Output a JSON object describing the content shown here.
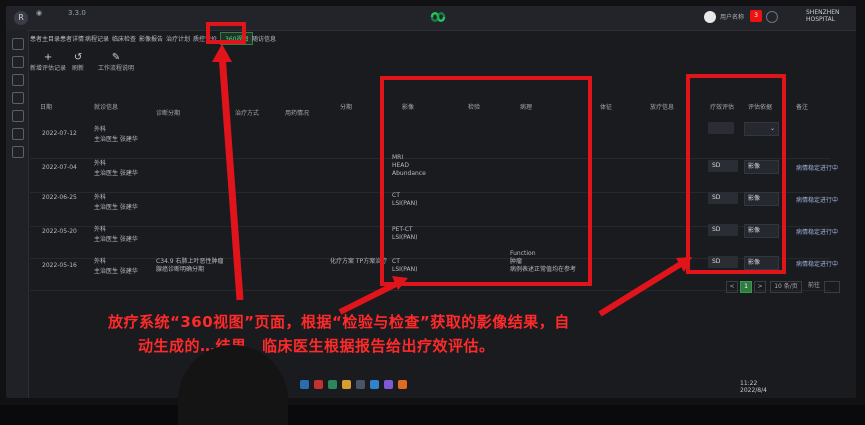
{
  "window": {
    "title_left_1": "R",
    "title_left_2": "3.3.0",
    "user_label": "用户名称",
    "notif_label": "3",
    "brand_text": "SHENZHEN HOSPITAL"
  },
  "menu": {
    "items": [
      "患者主目录",
      "患者详情",
      "病程记录",
      "临床检查",
      "影像报告",
      "治疗计划",
      "质控评价",
      "360视图",
      "随访信息"
    ],
    "active_index": 7
  },
  "toolbar": {
    "tools": [
      {
        "glyph": "+",
        "label": "新增评估记录"
      },
      {
        "glyph": "↺",
        "label": "刷新"
      },
      {
        "glyph": "✎",
        "label": "工作流程说明"
      }
    ]
  },
  "table": {
    "headers": [
      "日期",
      "就诊信息",
      "诊断分期",
      "治疗方式",
      "用药情况",
      "分期",
      "影像",
      "检验",
      "病理",
      "体征",
      "放疗信息",
      "疗效评估",
      "评估依据",
      "备注"
    ],
    "rows": [
      {
        "date": "2022-07-12",
        "visit": "外科",
        "sub": "主治医生 张建华",
        "imaging": "",
        "lab": "",
        "score": "",
        "select": "",
        "note": ""
      },
      {
        "date": "2022-07-04",
        "visit": "外科",
        "sub": "主治医生 张建华",
        "imaging": "MRI\nHEAD\nAbundance",
        "lab": "",
        "score": "SD",
        "select": "影像",
        "note": "病情稳定进行中"
      },
      {
        "date": "2022-06-25",
        "visit": "外科",
        "sub": "主治医生 张建华",
        "imaging": "CT\nLSI(PAN)",
        "lab": "",
        "score": "SD",
        "select": "影像",
        "note": "病情稳定进行中"
      },
      {
        "date": "2022-05-20",
        "visit": "外科",
        "sub": "主治医生 张建华",
        "imaging": "PET-CT\nLSI(PAN)",
        "lab": "",
        "score": "SD",
        "select": "影像",
        "note": "病情稳定进行中"
      },
      {
        "date": "2022-05-16",
        "visit": "外科",
        "sub": "主治医生 张建华",
        "imaging": "CT\nLSI(PAN)",
        "lab": "Function\n肿瘤\n病例表述正常值均在参考",
        "score": "SD",
        "select": "影像",
        "note": "病情稳定进行中",
        "diag": "C34.9 右肺上叶恶性肿瘤\n腺癌诊断明确分期",
        "treat": "化疗方案 TP方案治疗"
      }
    ]
  },
  "pager": {
    "prev": "<",
    "current": "1",
    "next": ">",
    "size_label": "10 条/页",
    "goto_label": "前往"
  },
  "caption": {
    "line1": "放疗系统“360视图”页面，根据“检验与检查”获取的影像结果，自",
    "line2": "动生成的…结果，临床医生根据报告给出疗效评估。"
  },
  "tray": {
    "time": "11:22",
    "date": "2022/8/4"
  },
  "colors": {
    "annotation_red": "#e1141c",
    "active_green": "#4ade80"
  }
}
